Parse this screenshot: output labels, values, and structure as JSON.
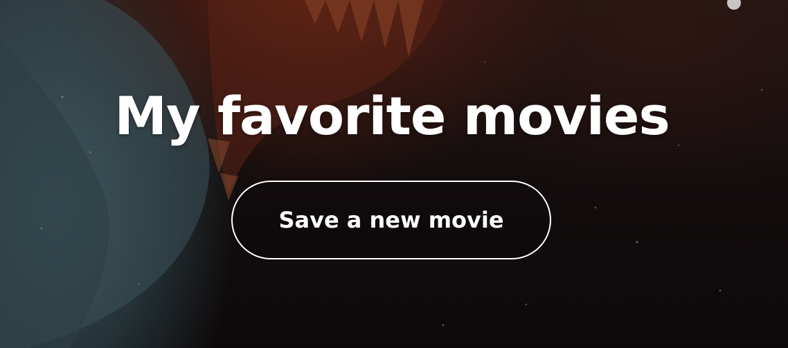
{
  "hero": {
    "title": "My favorite movies",
    "cta_label": "Save a new movie"
  },
  "background": {
    "image": "shark-jaws-poster-art",
    "colors": {
      "dark": "#120d0e",
      "teal": "#465c62",
      "rust": "#782812"
    }
  }
}
